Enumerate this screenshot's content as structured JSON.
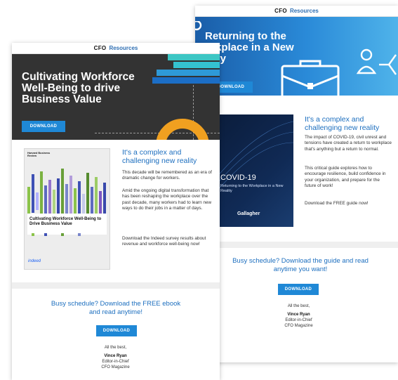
{
  "back_email": {
    "brand": "CFO",
    "brand_link": "Resources",
    "hero_title_lines": [
      "Returning to the",
      "orkplace in a New",
      "ality"
    ],
    "hero_button": "DOWNLOAD",
    "cover": {
      "subtitle_1": "COVID-19",
      "subtitle_2": "Returning to the Workplace in a New Reality",
      "brand": "Gallagher"
    },
    "heading": "It's a complex and challenging new reality",
    "paragraphs": [
      "The impact of COVID-19, civil unrest and tensions have created a return to workplace that's anything but a return to normal.",
      "This critical guide explores how to encourage resilience, build confidence in your organization, and prepare for the future of work!",
      "Download the FREE guide now!"
    ],
    "busy_text": "Busy schedule? Download the guide and read anytime you want!",
    "busy_button": "DOWNLOAD",
    "closing": "All the best,",
    "name": "Vince Ryan",
    "role": "Editor-in-Chief",
    "org": "CFO Magazine"
  },
  "front_email": {
    "brand": "CFO",
    "brand_link": "Resources",
    "hero_title": "Cultivating Workforce Well-Being to drive Business Value",
    "hero_button": "DOWNLOAD",
    "cover": {
      "publisher": "Harvard Business Review",
      "title": "Cultivating Workforce Well-Being to Drive Business Value",
      "sponsor": "indeed"
    },
    "heading": "It's a complex and challenging new reality",
    "paragraphs": [
      "This decade will be remembered as an era of dramatic change for workers.",
      "Amid the ongoing digital transformation that has been reshaping the workplace over the past decade, many workers had to learn new ways to do their jobs in a matter of days.",
      "Download the Indeed survey results about revenue and workforce well-being now!"
    ],
    "busy_text": "Busy schedule? Download the FREE ebook and read anytime!",
    "busy_button": "DOWNLOAD",
    "closing": "All the best,",
    "name": "Vince Ryan",
    "role": "Editor-in-Chief",
    "org": "CFO Magazine"
  },
  "colors": {
    "accent_blue": "#1f88d6",
    "hero_dark": "#333333",
    "orange": "#f0a020",
    "teal": "#30c8c8"
  }
}
